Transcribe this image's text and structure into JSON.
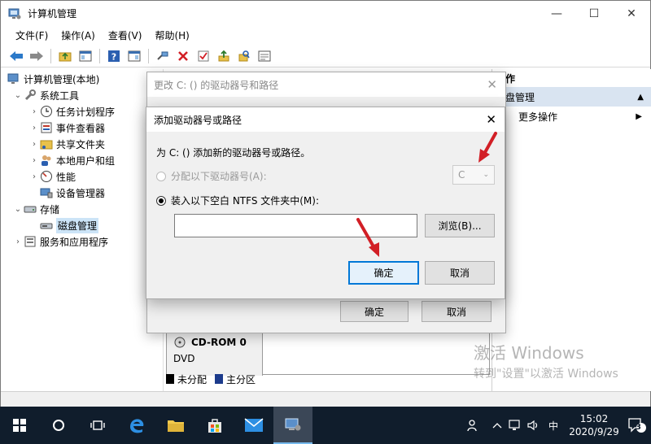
{
  "window": {
    "title": "计算机管理",
    "controls": {
      "minimize": "—",
      "maximize": "☐",
      "close": "✕"
    }
  },
  "menu": [
    "文件(F)",
    "操作(A)",
    "查看(V)",
    "帮助(H)"
  ],
  "tree": {
    "root": "计算机管理(本地)",
    "system_tools": "系统工具",
    "task_scheduler": "任务计划程序",
    "event_viewer": "事件查看器",
    "shared_folders": "共享文件夹",
    "local_users": "本地用户和组",
    "performance": "性能",
    "device_manager": "设备管理器",
    "storage": "存储",
    "disk_management": "磁盘管理",
    "services_apps": "服务和应用程序"
  },
  "actions": {
    "header": "作",
    "section": "盘管理",
    "more": "更多操作"
  },
  "disk": {
    "name": "CD-ROM 0",
    "type": "DVD",
    "legend_unallocated": "未分配",
    "legend_primary": "主分区"
  },
  "back_dialog": {
    "title": "更改 C: () 的驱动器号和路径",
    "ok": "确定",
    "cancel": "取消"
  },
  "front_dialog": {
    "title": "添加驱动器号或路径",
    "description": "为 C: () 添加新的驱动器号或路径。",
    "option_letter": "分配以下驱动器号(A):",
    "letter_value": "C",
    "option_folder": "装入以下空白 NTFS 文件夹中(M):",
    "path_value": "",
    "browse": "浏览(B)...",
    "ok": "确定",
    "cancel": "取消"
  },
  "watermark": {
    "line1": "激活 Windows",
    "line2": "转到\"设置\"以激活 Windows"
  },
  "taskbar": {
    "time": "15:02",
    "date": "2020/9/29",
    "ime": "中",
    "notification_count": "3"
  },
  "colors": {
    "accent": "#0078d7",
    "arrow_red": "#d21f26",
    "taskbar": "#101d2c",
    "selection": "#cce4f7"
  }
}
